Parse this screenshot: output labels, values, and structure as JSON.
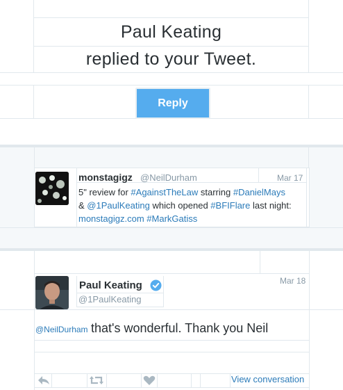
{
  "notification": {
    "line1": "Paul Keating",
    "line2": "replied to your Tweet.",
    "reply_label": "Reply"
  },
  "quoted_tweet": {
    "name": "monstagigz",
    "handle": "@NeilDurham",
    "date": "Mar 17",
    "text": [
      {
        "t": "5\" review for ",
        "link": false
      },
      {
        "t": "#AgainstTheLaw",
        "link": true
      },
      {
        "t": " starring ",
        "link": false
      },
      {
        "t": "#DanielMays",
        "link": true
      },
      {
        "t": " & ",
        "link": false
      },
      {
        "t": "@1PaulKeating",
        "link": true
      },
      {
        "t": " which opened ",
        "link": false
      },
      {
        "t": "#BFIFlare",
        "link": true
      },
      {
        "t": " last night: ",
        "link": false
      },
      {
        "t": "monstagigz.com",
        "link": true
      },
      {
        "t": " ",
        "link": false
      },
      {
        "t": "#MarkGatiss",
        "link": true
      }
    ]
  },
  "reply_tweet": {
    "name": "Paul Keating",
    "handle": "@1PaulKeating",
    "date": "Mar 18",
    "mention": "@NeilDurham",
    "text": "that's wonderful. Thank you Neil",
    "view_conversation": "View conversation"
  },
  "icons": [
    "reply-icon",
    "retweet-icon",
    "heart-icon",
    "verified-badge-icon"
  ],
  "colors": {
    "accent": "#55acee",
    "link": "#2b7bb9",
    "muted": "#8899a6",
    "text": "#292f33"
  }
}
